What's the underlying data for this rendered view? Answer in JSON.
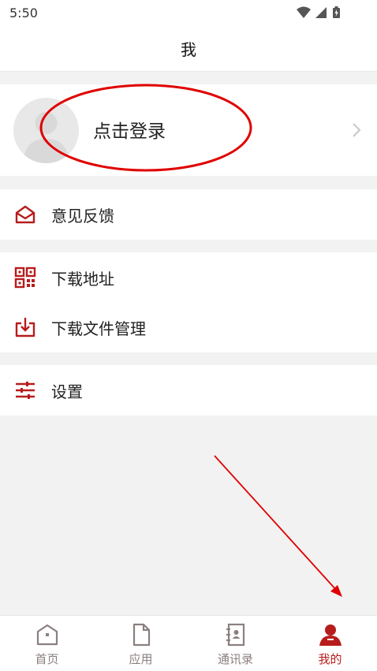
{
  "status_bar": {
    "time": "5:50"
  },
  "header": {
    "title": "我"
  },
  "profile": {
    "login_label": "点击登录"
  },
  "menu": {
    "feedback": "意见反馈",
    "download_address": "下载地址",
    "download_manager": "下载文件管理",
    "settings": "设置"
  },
  "tabs": [
    {
      "label": "首页",
      "active": false
    },
    {
      "label": "应用",
      "active": false
    },
    {
      "label": "通讯录",
      "active": false
    },
    {
      "label": "我的",
      "active": true
    }
  ],
  "colors": {
    "accent": "#b71c1c",
    "inactive_tab": "#8a7f7f",
    "annotation": "#e00000",
    "background": "#f2f2f2"
  }
}
